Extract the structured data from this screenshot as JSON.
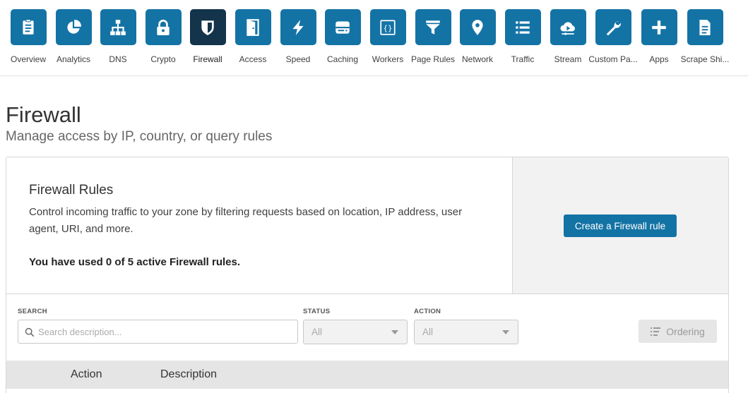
{
  "nav": {
    "items": [
      {
        "label": "Overview",
        "icon": "overview-doc-icon"
      },
      {
        "label": "Analytics",
        "icon": "pie-chart-icon"
      },
      {
        "label": "DNS",
        "icon": "network-tree-icon"
      },
      {
        "label": "Crypto",
        "icon": "lock-icon"
      },
      {
        "label": "Firewall",
        "icon": "shield-icon",
        "active": true
      },
      {
        "label": "Access",
        "icon": "door-icon"
      },
      {
        "label": "Speed",
        "icon": "lightning-icon"
      },
      {
        "label": "Caching",
        "icon": "server-drive-icon"
      },
      {
        "label": "Workers",
        "icon": "code-braces-icon"
      },
      {
        "label": "Page Rules",
        "icon": "filter-funnel-icon"
      },
      {
        "label": "Network",
        "icon": "map-pin-icon"
      },
      {
        "label": "Traffic",
        "icon": "list-icon"
      },
      {
        "label": "Stream",
        "icon": "cloud-play-icon"
      },
      {
        "label": "Custom Pa...",
        "icon": "wrench-icon"
      },
      {
        "label": "Apps",
        "icon": "plus-icon"
      },
      {
        "label": "Scrape Shi...",
        "icon": "document-icon"
      }
    ]
  },
  "page": {
    "title": "Firewall",
    "subtitle": "Manage access by IP, country, or query rules"
  },
  "rules_card": {
    "title": "Firewall Rules",
    "description": "Control incoming traffic to your zone by filtering requests based on location, IP address, user agent, URI, and more.",
    "usage": "You have used 0 of 5 active Firewall rules.",
    "create_button": "Create a Firewall rule"
  },
  "filters": {
    "search_label": "SEARCH",
    "search_placeholder": "Search description...",
    "status_label": "STATUS",
    "status_value": "All",
    "action_label": "ACTION",
    "action_value": "All",
    "ordering_button": "Ordering"
  },
  "table": {
    "columns": [
      "Action",
      "Description"
    ]
  },
  "colors": {
    "accent": "#1473a5",
    "active_tile": "#13344a"
  }
}
